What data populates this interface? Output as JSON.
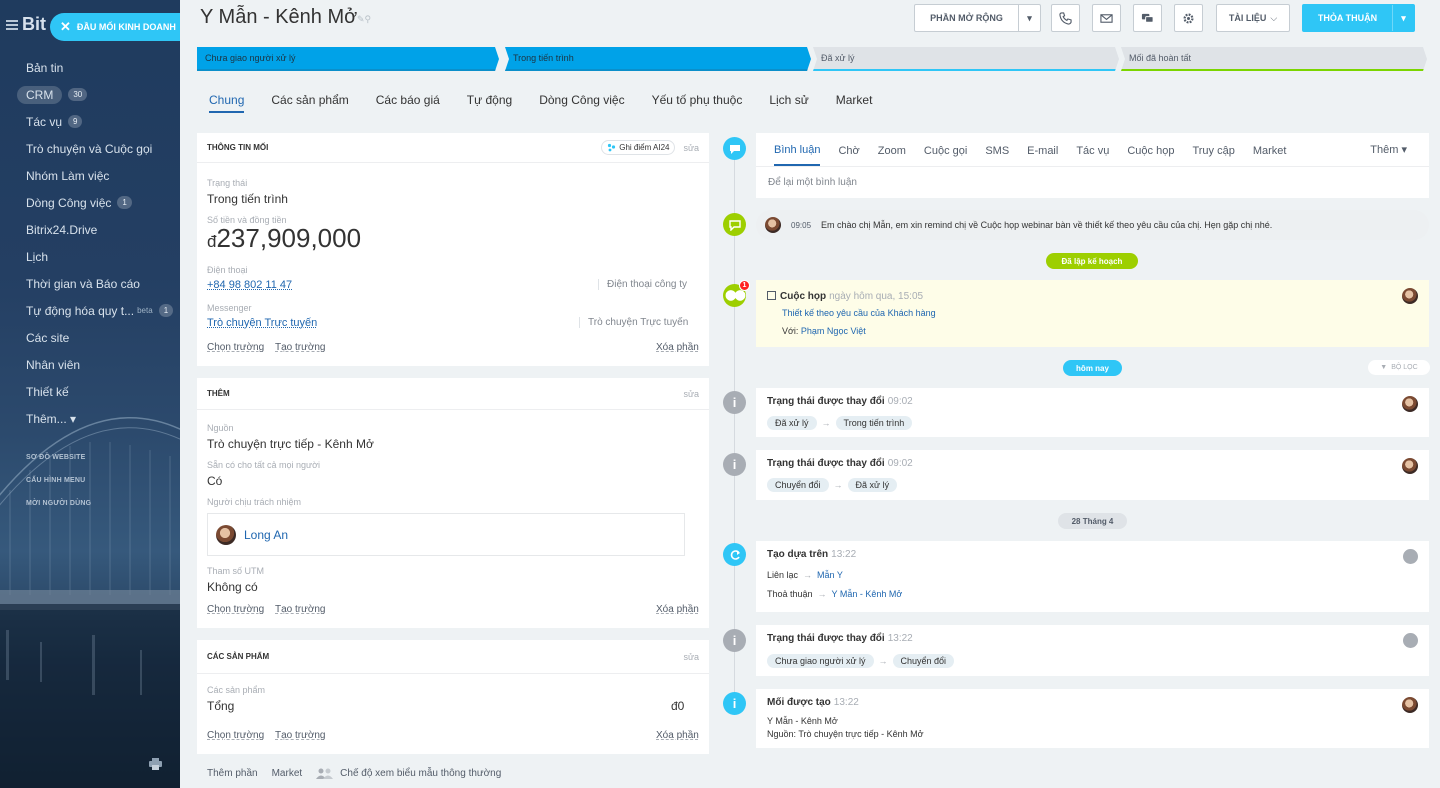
{
  "sidebar": {
    "logo": "Bit",
    "deal_button": "ĐẦU MỐI KINH DOANH",
    "items": [
      {
        "label": "Bản tin",
        "count": null
      },
      {
        "label": "CRM",
        "count": "30"
      },
      {
        "label": "Tác vụ",
        "count": "9"
      },
      {
        "label": "Trò chuyện và Cuộc gọi",
        "count": null
      },
      {
        "label": "Nhóm Làm việc",
        "count": null
      },
      {
        "label": "Dòng Công việc",
        "count": "1"
      },
      {
        "label": "Bitrix24.Drive",
        "count": null
      },
      {
        "label": "Lịch",
        "count": null
      },
      {
        "label": "Thời gian và Báo cáo",
        "count": null
      },
      {
        "label": "Tự động hóa quy t...",
        "beta": "beta",
        "count": "1"
      },
      {
        "label": "Các site",
        "count": null
      },
      {
        "label": "Nhân viên",
        "count": null
      },
      {
        "label": "Thiết kế",
        "count": null
      },
      {
        "label": "Thêm... ▾",
        "count": null
      }
    ],
    "sections": [
      "SƠ ĐỒ WEBSITE",
      "CẤU HÌNH MENU",
      "MỜI NGƯỜI DÙNG"
    ]
  },
  "header": {
    "title": "Y Mẫn - Kênh  Mở",
    "extensions": "PHẦN MỞ RỘNG",
    "documents": "TÀI LIỆU",
    "deal": "THỎA THUẬN"
  },
  "stages": [
    "Chưa giao người xử lý",
    "Trong tiến trình",
    "Đã xử lý",
    "Mối đã hoàn tất"
  ],
  "tabs": [
    "Chung",
    "Các sản phẩm",
    "Các báo giá",
    "Tự động",
    "Dòng Công việc",
    "Yếu tố phụ thuộc",
    "Lịch sử",
    "Market"
  ],
  "card_info": {
    "title": "THÔNG TIN MỐI",
    "ai_chip": "Ghi điểm AI24",
    "edit": "sửa",
    "status_label": "Trạng thái",
    "status_value": "Trong tiến trình",
    "amount_label": "Số tiền và đồng tiền",
    "currency": "đ",
    "amount": "237,909,000",
    "phone_label": "Điện thoại",
    "phone": "+84 98 802 11 47",
    "phone_type": "Điện thoại công ty",
    "messenger_label": "Messenger",
    "messenger": "Trò chuyện Trực tuyến",
    "messenger_type": "Trò chuyện Trực tuyến",
    "choose_field": "Chọn trường",
    "create_field": "Tạo trường",
    "delete_section": "Xóa phần"
  },
  "card_more": {
    "title": "THÊM",
    "edit": "sửa",
    "source_label": "Nguồn",
    "source": "Trò chuyện trực tiếp - Kênh Mở",
    "available_label": "Sẵn có cho tất cả mọi người",
    "available": "Có",
    "responsible_label": "Người chịu trách nhiệm",
    "responsible": "Long An",
    "utm_label": "Tham số UTM",
    "utm": "Không có",
    "choose_field": "Chọn trường",
    "create_field": "Tạo trường",
    "delete_section": "Xóa phần"
  },
  "card_products": {
    "title": "CÁC SẢN PHẨM",
    "edit": "sửa",
    "products_label": "Các sản phẩm",
    "total_label": "Tổng",
    "total": "đ0",
    "choose_field": "Chọn trường",
    "create_field": "Tạo trường",
    "delete_section": "Xóa phần"
  },
  "bottom_links": {
    "add_section": "Thêm phần",
    "market": "Market",
    "view_mode": "Chế độ xem biểu mẫu thông thường"
  },
  "editor": {
    "tabs": [
      "Bình luận",
      "Chờ",
      "Zoom",
      "Cuộc gọi",
      "SMS",
      "E-mail",
      "Tác vụ",
      "Cuộc họp",
      "Truy cập",
      "Market"
    ],
    "more": "Thêm ▾",
    "placeholder": "Để lại một bình luận"
  },
  "timeline": {
    "message": {
      "time": "09:05",
      "text": "Em chào chị Mẫn, em xin remind chị về Cuộc họp webinar bàn về thiết kế theo yêu cầu của chị. Hẹn gặp chị nhé."
    },
    "planned": "Đã lập kế hoạch",
    "meeting": {
      "title": "Cuộc họp",
      "when": "ngày hôm qua, 15:05",
      "subject": "Thiết kế theo yêu cầu của Khách hàng",
      "with_label": "Với:",
      "with": "Phạm Ngọc Việt",
      "badge": "1"
    },
    "today": "hôm nay",
    "filter": "BỘ LỌC",
    "status1": {
      "title": "Trạng thái được thay đổi",
      "time": "09:02",
      "from": "Đã xử lý",
      "to": "Trong tiến trình"
    },
    "status2": {
      "title": "Trạng thái được thay đổi",
      "time": "09:02",
      "from": "Chuyển đổi",
      "to": "Đã xử lý"
    },
    "date": "28 Tháng 4",
    "created_on": {
      "title": "Tạo dựa trên",
      "time": "13:22",
      "contact_label": "Liên lạc",
      "contact": "Mẫn Y",
      "deal_label": "Thoả thuận",
      "deal": "Y Mẫn - Kênh Mở"
    },
    "status3": {
      "title": "Trạng thái được thay đổi",
      "time": "13:22",
      "from": "Chưa giao người xử lý",
      "to": "Chuyển đổi"
    },
    "lead_created": {
      "title": "Mối được tạo",
      "time": "13:22",
      "name": "Y Mẫn - Kênh Mở",
      "source": "Nguồn: Trò chuyện trực tiếp - Kênh Mở"
    }
  }
}
